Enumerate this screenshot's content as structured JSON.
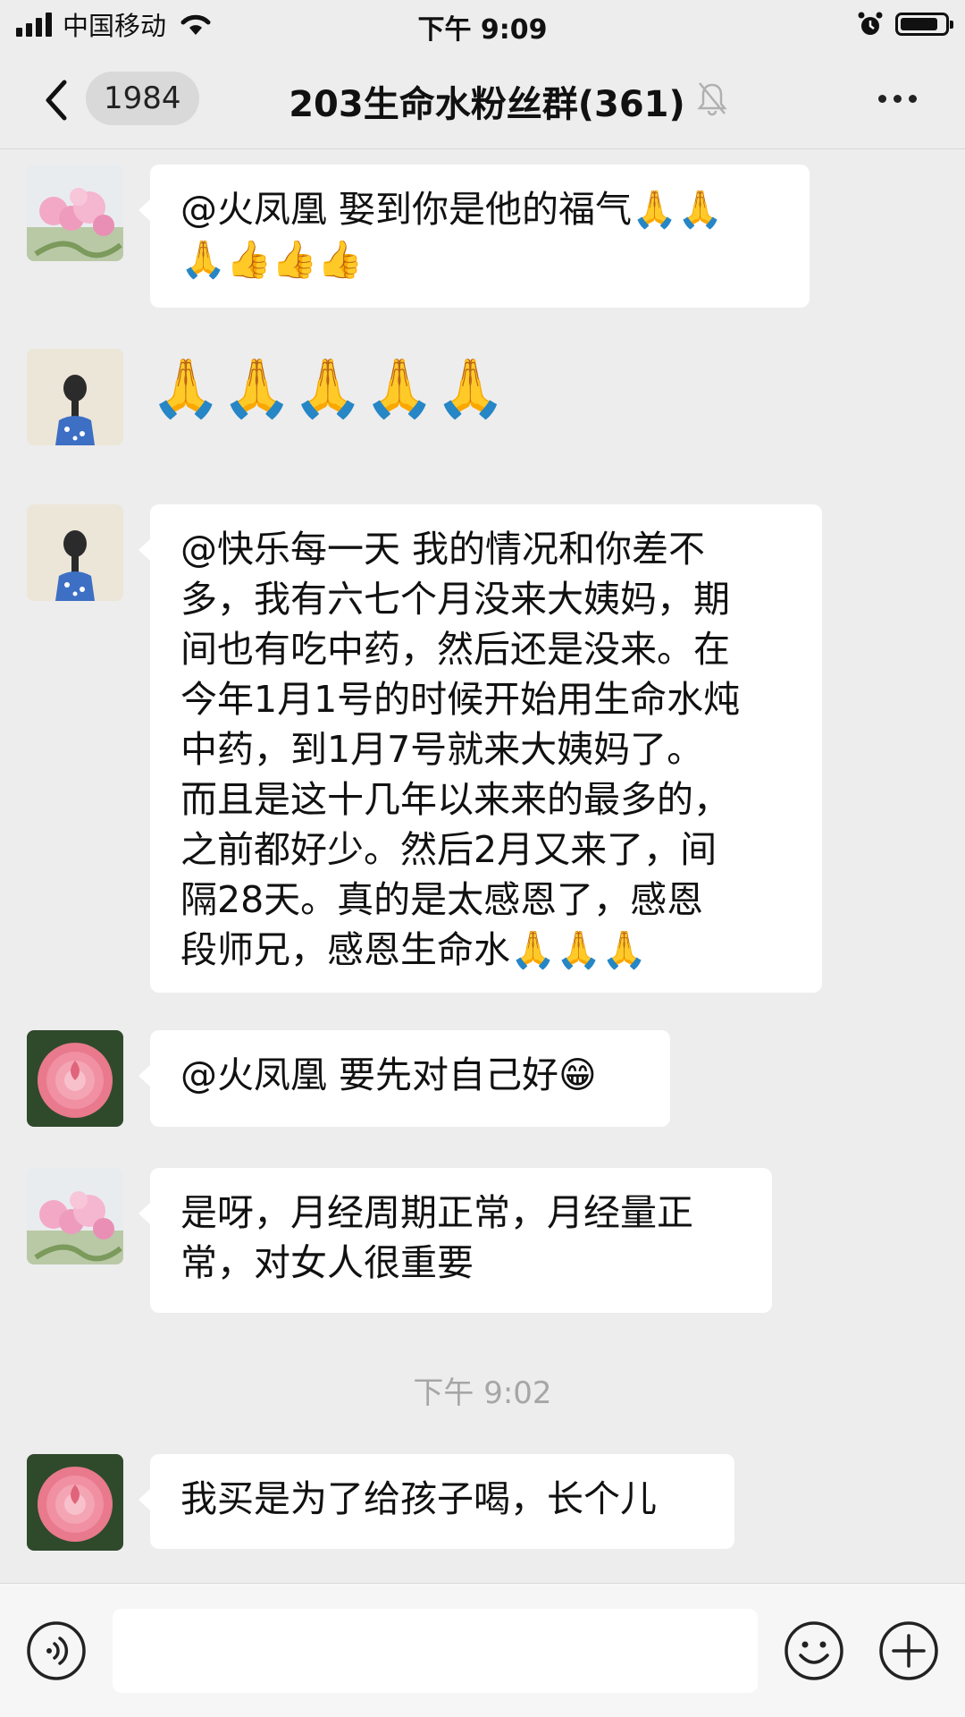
{
  "status_bar": {
    "carrier": "中国移动",
    "time": "下午 9:09",
    "battery_level": 0.85,
    "icons": [
      "signal-icon",
      "wifi-icon",
      "alarm-icon",
      "battery-icon"
    ]
  },
  "header": {
    "back_icon": "chevron-left-icon",
    "unread_count": "1984",
    "title": "203生命水粉丝群(361)",
    "mute_icon": "bell-muted-icon",
    "more_icon": "more-dots-icon"
  },
  "messages": [
    {
      "type": "text",
      "avatar": "pink-flower",
      "text": "@火凤凰 娶到你是他的福气🙏🙏\n🙏👍👍👍"
    },
    {
      "type": "emoji",
      "avatar": "girl-braid",
      "text": "🙏🙏🙏🙏🙏"
    },
    {
      "type": "text",
      "avatar": "girl-braid",
      "text": "@快乐每一天 我的情况和你差不\n多，我有六七个月没来大姨妈，期\n间也有吃中药，然后还是没来。在\n今年1月1号的时候开始用生命水炖\n中药，到1月7号就来大姨妈了。\n而且是这十几年以来来的最多的，\n之前都好少。然后2月又来了，间\n隔28天。真的是太感恩了，感恩\n段师兄，感恩生命水🙏🙏🙏"
    },
    {
      "type": "text",
      "avatar": "camellia",
      "text": "@火凤凰 要先对自己好😁"
    },
    {
      "type": "text",
      "avatar": "pink-flower",
      "text": "是呀，月经周期正常，月经量正\n常，对女人很重要"
    },
    {
      "type": "time",
      "text": "下午 9:02"
    },
    {
      "type": "text",
      "avatar": "camellia",
      "text": "我买是为了给孩子喝，长个儿"
    }
  ],
  "input_bar": {
    "voice_icon": "voice-icon",
    "input_value": "",
    "emoji_icon": "smiley-icon",
    "plus_icon": "plus-icon"
  },
  "colors": {
    "background": "#ededed",
    "bubble": "#ffffff",
    "time_text": "#a6a6a6",
    "input_bar": "#f6f6f6"
  }
}
